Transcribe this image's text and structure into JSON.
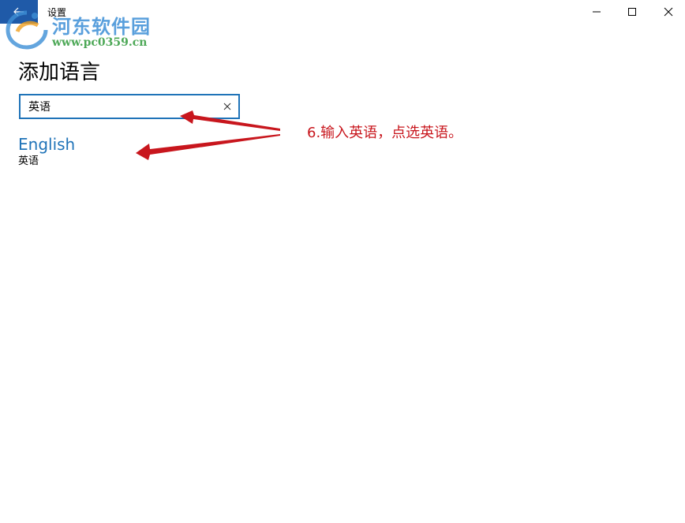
{
  "window": {
    "title": "设置"
  },
  "watermark": {
    "site_name": "河东软件园",
    "url": "www.pc0359.cn"
  },
  "page": {
    "title": "添加语言"
  },
  "search": {
    "value": "英语",
    "placeholder": ""
  },
  "results": [
    {
      "name": "English",
      "native_name": "英语"
    }
  ],
  "annotation": {
    "text": "6.输入英语，点选英语。",
    "color": "#c8161d"
  },
  "colors": {
    "accent": "#1f73b8",
    "back_button": "#1f5aa8"
  },
  "icons": {
    "back": "back-arrow-icon",
    "minimize": "minimize-icon",
    "maximize": "maximize-icon",
    "close": "close-icon",
    "clear": "clear-icon"
  }
}
